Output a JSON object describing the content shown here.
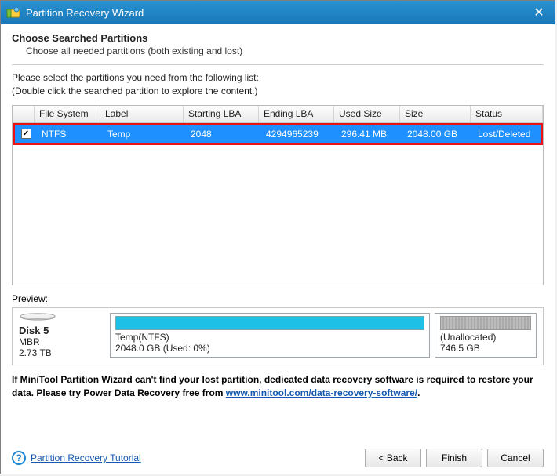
{
  "window": {
    "title": "Partition Recovery Wizard"
  },
  "header": {
    "heading": "Choose Searched Partitions",
    "sub": "Choose all needed partitions (both existing and lost)"
  },
  "instructions": {
    "l1": "Please select the partitions you need from the following list:",
    "l2": "(Double click the searched partition to explore the content.)"
  },
  "table": {
    "cols": {
      "fs": "File System",
      "label": "Label",
      "slba": "Starting LBA",
      "elba": "Ending LBA",
      "used": "Used Size",
      "size": "Size",
      "status": "Status"
    },
    "rows": [
      {
        "checked": "☑",
        "fs": "NTFS",
        "label": "Temp",
        "slba": "2048",
        "elba": "4294965239",
        "used": "296.41 MB",
        "size": "2048.00 GB",
        "status": "Lost/Deleted"
      }
    ]
  },
  "preview": {
    "label": "Preview:",
    "disk": {
      "name": "Disk 5",
      "type": "MBR",
      "cap": "2.73 TB"
    },
    "parts": [
      {
        "title": "Temp(NTFS)",
        "sub": "2048.0 GB (Used: 0%)"
      },
      {
        "title": "(Unallocated)",
        "sub": "746.5 GB"
      }
    ]
  },
  "note": {
    "pre": "If MiniTool Partition Wizard can't find your lost partition, dedicated data recovery software is required to restore your data. Please try Power Data Recovery free from ",
    "link": "www.minitool.com/data-recovery-software/",
    "post": "."
  },
  "footer": {
    "tutorial": "Partition Recovery Tutorial",
    "back": "< Back",
    "finish": "Finish",
    "cancel": "Cancel"
  }
}
